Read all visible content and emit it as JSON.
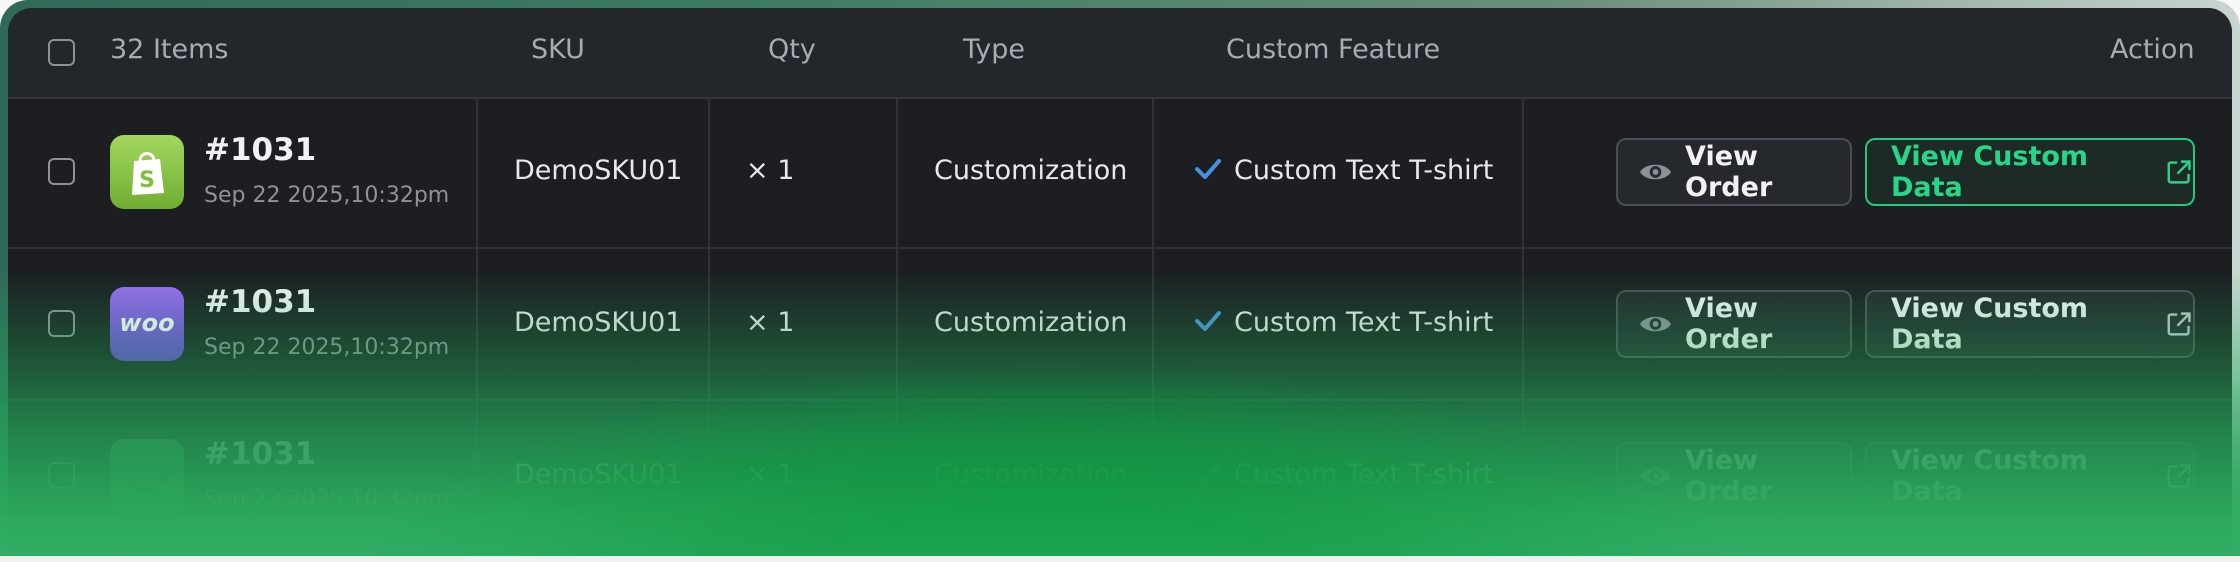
{
  "header": {
    "items_label": "32 Items",
    "sku_label": "SKU",
    "qty_label": "Qty",
    "type_label": "Type",
    "feature_label": "Custom Feature",
    "action_label": "Action"
  },
  "rows": [
    {
      "logo": "shopify-icon",
      "order": "#1031",
      "date": "Sep 22 2025,10:32pm",
      "sku": "DemoSKU01",
      "qty": "× 1",
      "type": "Customization",
      "feature": "Custom Text T-shirt",
      "view_order": "View Order",
      "view_custom": "View Custom Data"
    },
    {
      "logo": "woo-icon",
      "logo_text": "woo",
      "order": "#1031",
      "date": "Sep 22 2025,10:32pm",
      "sku": "DemoSKU01",
      "qty": "× 1",
      "type": "Customization",
      "feature": "Custom Text T-shirt",
      "view_order": "View Order",
      "view_custom": "View Custom Data"
    },
    {
      "logo": "smile-logo-icon",
      "order": "#1031",
      "date": "Sep 22 2025,10:32pm",
      "sku": "DemoSKU01",
      "qty": "× 1",
      "type": "Customization",
      "feature": "Custom Text T-shirt",
      "view_order": "View Order",
      "view_custom": "View Custom Data"
    }
  ],
  "colors": {
    "accent": "#1fc97f",
    "check": "#4a90e2",
    "shopify": "#8cc63f",
    "woo": "#7f54b3"
  }
}
